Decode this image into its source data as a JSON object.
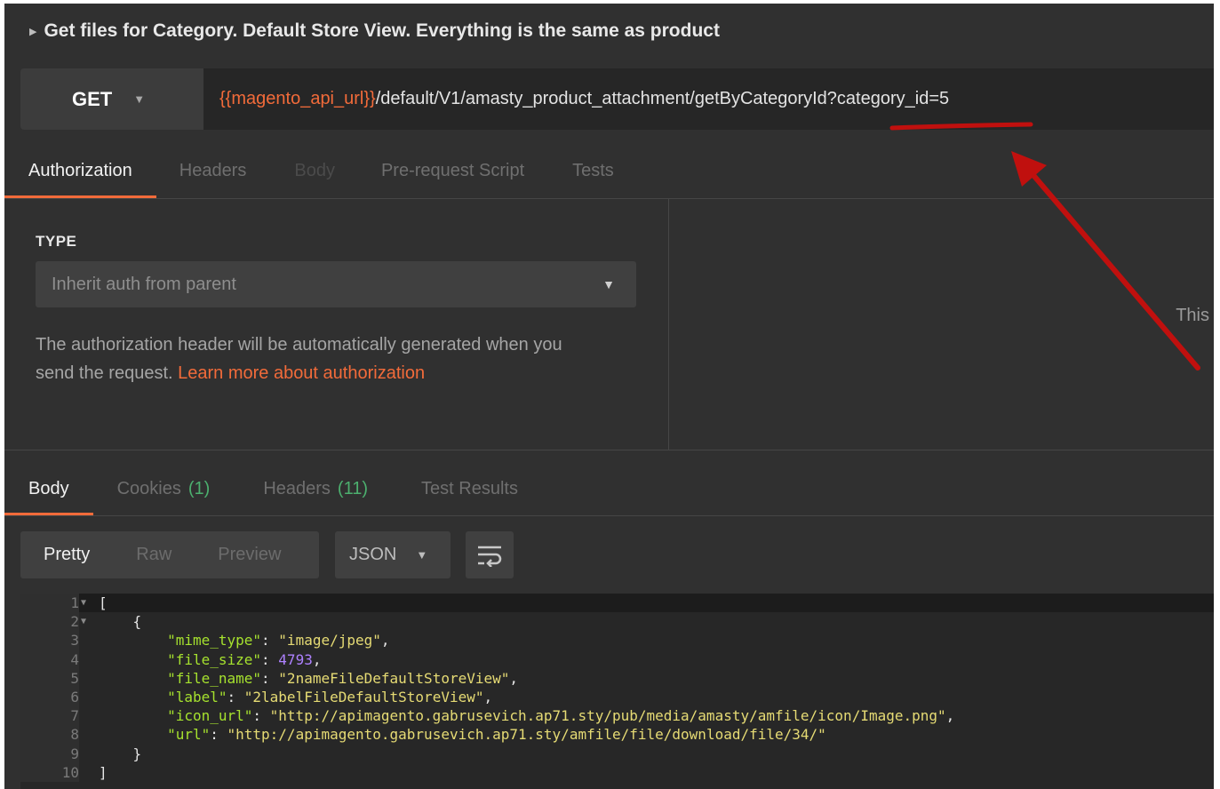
{
  "request": {
    "title": "Get files for Category. Default Store View. Everything is the same as product",
    "method": "GET",
    "url_variable": "{{magento_api_url}}",
    "url_path": "/default/V1/amasty_product_attachment/getByCategoryId?category_id=5"
  },
  "request_tabs": [
    "Authorization",
    "Headers",
    "Body",
    "Pre-request Script",
    "Tests"
  ],
  "auth": {
    "type_label": "TYPE",
    "type_value": "Inherit auth from parent",
    "desc_line1": "The authorization header will be automatically generated when you",
    "desc_line2": "send the request. ",
    "link": "Learn more about authorization",
    "right_hint": "This"
  },
  "response_tabs": {
    "body": "Body",
    "cookies": "Cookies",
    "cookies_count": "(1)",
    "headers": "Headers",
    "headers_count": "(11)",
    "test_results": "Test Results"
  },
  "view_modes": [
    "Pretty",
    "Raw",
    "Preview"
  ],
  "format": "JSON",
  "icons": {
    "method_caret": "chevron-down-icon",
    "type_caret": "chevron-down-icon",
    "format_caret": "chevron-down-icon",
    "wrap": "wrap-lines-icon",
    "title_caret": "triangle-right-icon"
  },
  "colors": {
    "accent": "#f26b3a",
    "count": "#4caf6e",
    "annotation_red": "#c0100e"
  },
  "code_lines": [
    {
      "num": "1",
      "fold": true
    },
    {
      "num": "2",
      "fold": true
    },
    {
      "num": "3",
      "key": "\"mime_type\"",
      "value": "\"image/jpeg\"",
      "vtype": "s",
      "trail": ","
    },
    {
      "num": "4",
      "key": "\"file_size\"",
      "value": "4793",
      "vtype": "n",
      "trail": ","
    },
    {
      "num": "5",
      "key": "\"file_name\"",
      "value": "\"2nameFileDefaultStoreView\"",
      "vtype": "s",
      "trail": ","
    },
    {
      "num": "6",
      "key": "\"label\"",
      "value": "\"2labelFileDefaultStoreView\"",
      "vtype": "s",
      "trail": ","
    },
    {
      "num": "7",
      "key": "\"icon_url\"",
      "value": "\"http://apimagento.gabrusevich.ap71.sty/pub/media/amasty/amfile/icon/Image.png\"",
      "vtype": "s",
      "trail": ","
    },
    {
      "num": "8",
      "key": "\"url\"",
      "value": "\"http://apimagento.gabrusevich.ap71.sty/amfile/file/download/file/34/\"",
      "vtype": "s",
      "trail": ""
    },
    {
      "num": "9"
    },
    {
      "num": "10"
    }
  ],
  "code_text": {
    "l1": "[",
    "l2": "    {",
    "l9": "    }",
    "l10": "]"
  }
}
